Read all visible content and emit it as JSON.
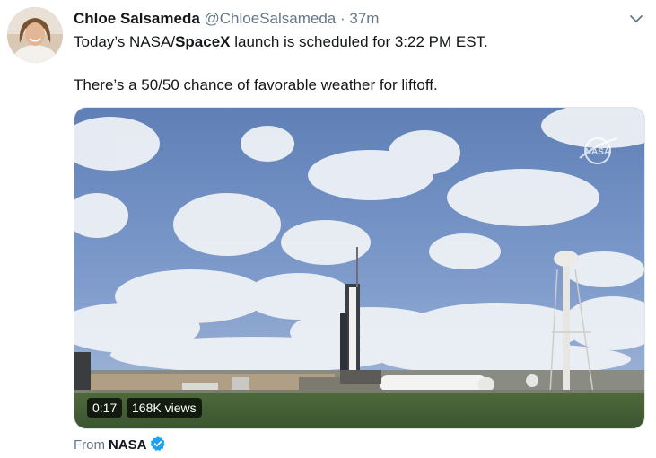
{
  "tweet": {
    "author_name": "Chloe Salsameda",
    "handle": "@ChloeSalsameda",
    "separator": "·",
    "time": "37m",
    "text_line1_pre": "Today’s NASA/",
    "text_line1_bold": "SpaceX",
    "text_line1_post": " launch is scheduled for 3:22 PM EST.",
    "text_line2": "There’s a 50/50 chance of favorable weather for liftoff."
  },
  "media": {
    "duration": "0:17",
    "views": "168K views",
    "watermark": "NASA"
  },
  "footer": {
    "from_label": "From",
    "source": "NASA"
  },
  "icons": {
    "more": "chevron-down-icon",
    "verified": "verified-badge-icon"
  },
  "colors": {
    "accent": "#1da1f2",
    "secondary_text": "#657786"
  }
}
